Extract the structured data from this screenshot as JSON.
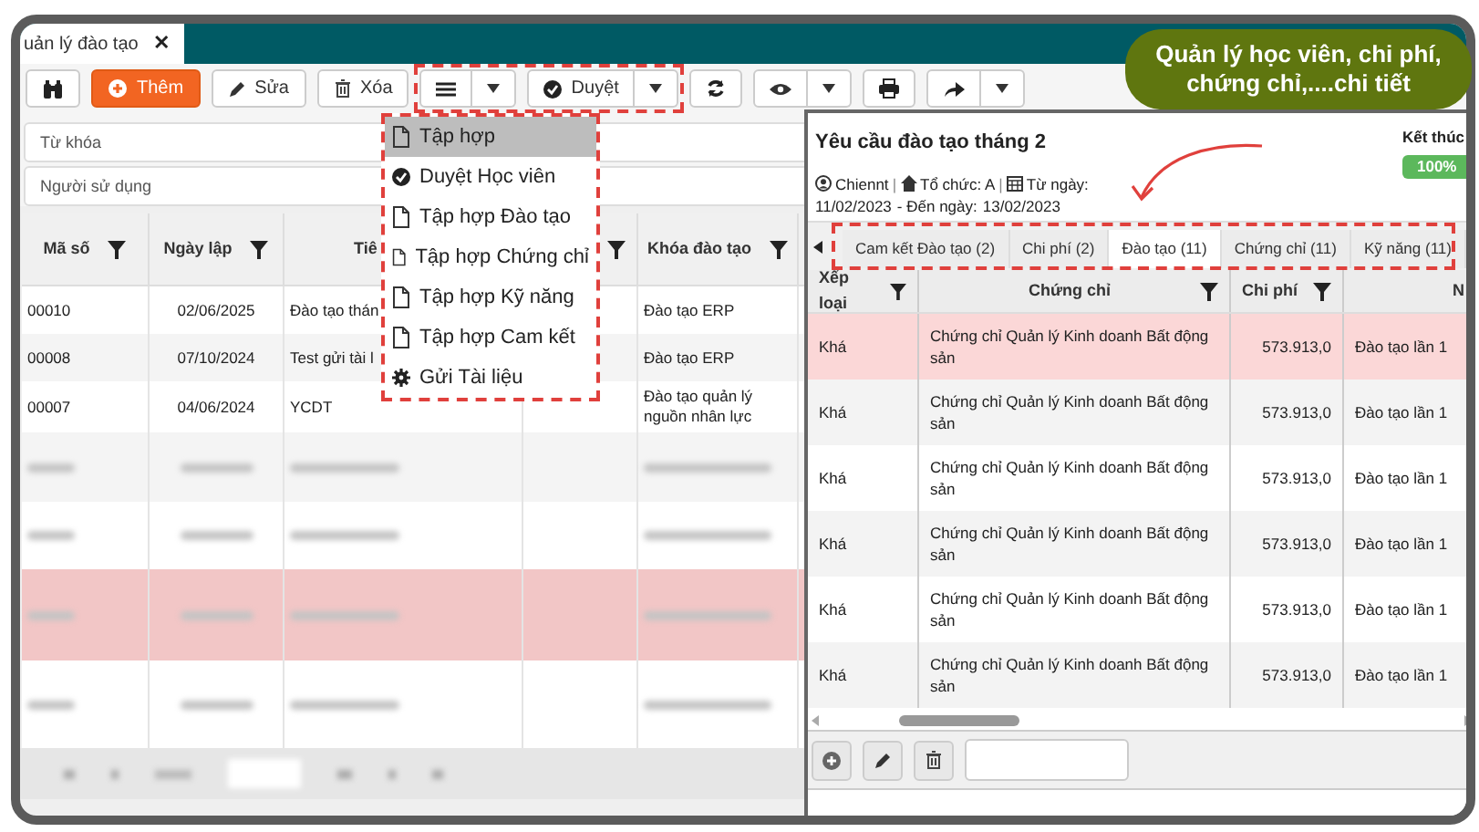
{
  "window": {
    "tab": {
      "title": "uản lý đào tạo",
      "close": "✕"
    }
  },
  "toolbar": {
    "buttons": [
      {
        "kind": "icon"
      },
      {
        "kind": "primary",
        "label": "Thêm"
      },
      {
        "kind": "plain",
        "label": "Sửa"
      },
      {
        "kind": "plain",
        "label": "Xóa"
      },
      {
        "kind": "menu"
      },
      {
        "kind": "split",
        "label": "Duyệt"
      },
      {
        "kind": "icon"
      },
      {
        "kind": "menu"
      },
      {
        "kind": "icon"
      },
      {
        "kind": "menu"
      }
    ]
  },
  "filters": [
    {
      "placeholder": "Từ khóa"
    },
    {
      "placeholder": "Người sử dụng"
    }
  ],
  "menu": {
    "items": [
      {
        "label": "Tập hợp",
        "selected": true
      },
      {
        "label": "Duyệt Học viên",
        "selected": false
      },
      {
        "label": "Tập hợp Đào tạo",
        "selected": false
      },
      {
        "label": "Tập hợp Chứng chỉ",
        "selected": false
      },
      {
        "label": "Tập hợp Kỹ năng",
        "selected": false
      },
      {
        "label": "Tập hợp Cam kết",
        "selected": false
      },
      {
        "label": "Gửi Tài liệu",
        "selected": false
      }
    ]
  },
  "table": {
    "columns": [
      "Mã số",
      "Ngày lập",
      "Tiê",
      "",
      "Khóa đào tạo"
    ],
    "rows": [
      {
        "blurred": false,
        "highlighted": false,
        "cells": [
          "00010",
          "02/06/2025",
          "Đào tạo thán",
          "",
          "Đào tạo ERP"
        ]
      },
      {
        "blurred": false,
        "highlighted": false,
        "cells": [
          "00008",
          "07/10/2024",
          "Test gửi tài l",
          "",
          "Đào tạo ERP"
        ]
      },
      {
        "blurred": false,
        "highlighted": false,
        "cells": [
          "00007",
          "04/06/2024",
          "YCDT",
          "",
          "Đào tạo quản lý nguồn nhân lực"
        ]
      },
      {
        "blurred": true,
        "highlighted": false
      },
      {
        "blurred": true,
        "highlighted": false
      },
      {
        "blurred": true,
        "highlighted": true
      },
      {
        "blurred": true,
        "highlighted": false
      }
    ]
  },
  "detail": {
    "title": "Yêu cầu đào tạo tháng 2",
    "user": "Chiennt",
    "separators": [
      "|",
      "|"
    ],
    "org": "Tổ chức: A",
    "from_label": "Từ ngày:",
    "from": "11/02/2023",
    "to_label": "- Đến ngày:",
    "to": "13/02/2023",
    "status": "Kết thúc",
    "progress": {
      "level": 1,
      "reading": "100%"
    },
    "tabs": [
      {
        "label": "Cam kết Đào tạo (2)",
        "selected": false
      },
      {
        "label": "Chi phí (2)",
        "selected": false
      },
      {
        "label": "Đào tạo (11)",
        "selected": true
      },
      {
        "label": "Chứng chỉ (11)",
        "selected": false
      },
      {
        "label": "Kỹ năng (11)",
        "selected": false
      }
    ],
    "columns": [
      "Xếp loại",
      "Chứng chỉ",
      "Chi phí",
      "N"
    ],
    "rows": [
      {
        "highlighted": true,
        "cells": [
          "Khá",
          "Chứng chỉ Quản lý Kinh doanh Bất động sản",
          "573.913,0",
          "Đào tạo lần 1"
        ]
      },
      {
        "highlighted": false,
        "cells": [
          "Khá",
          "Chứng chỉ Quản lý Kinh doanh Bất động sản",
          "573.913,0",
          "Đào tạo lần 1"
        ]
      },
      {
        "highlighted": false,
        "cells": [
          "Khá",
          "Chứng chỉ Quản lý Kinh doanh Bất động sản",
          "573.913,0",
          "Đào tạo lần 1"
        ]
      },
      {
        "highlighted": false,
        "cells": [
          "Khá",
          "Chứng chỉ Quản lý Kinh doanh Bất động sản",
          "573.913,0",
          "Đào tạo lần 1"
        ]
      },
      {
        "highlighted": false,
        "cells": [
          "Khá",
          "Chứng chỉ Quản lý Kinh doanh Bất động sản",
          "573.913,0",
          "Đào tạo lần 1"
        ]
      },
      {
        "highlighted": false,
        "cells": [
          "Khá",
          "Chứng chỉ Quản lý Kinh doanh Bất động sản",
          "573.913,0",
          "Đào tạo lần 1"
        ]
      }
    ]
  },
  "callout": "Quản lý học viên, chi phí, chứng chỉ,....chi tiết"
}
